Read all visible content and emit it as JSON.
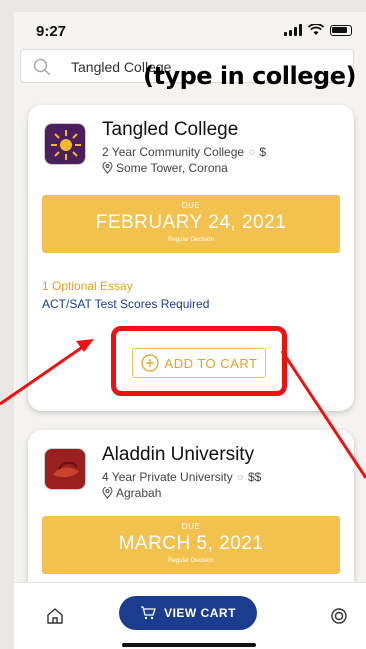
{
  "status_bar": {
    "time": "9:27"
  },
  "search": {
    "value": "Tangled College"
  },
  "annotation": {
    "text": "(type in college)"
  },
  "cards": [
    {
      "name": "Tangled College",
      "type": "2 Year Community College",
      "cost": "$",
      "location": "Some Tower, Corona",
      "due_label": "DUE",
      "due_date": "FEBRUARY 24, 2021",
      "decision": "Regular Decision",
      "essays": "1 Optional Essay",
      "tests": "ACT/SAT Test Scores Required",
      "add_to_cart": "ADD TO CART"
    },
    {
      "name": "Aladdin University",
      "type": "4 Year Private University",
      "cost": "$$",
      "location": "Agrabah",
      "due_label": "DUE",
      "due_date": "MARCH 5, 2021",
      "decision": "Regular Decision"
    }
  ],
  "bottom_bar": {
    "view_cart": "VIEW CART"
  },
  "colors": {
    "due_box": "#f2c14e",
    "accent_gold": "#e0a320",
    "primary_blue": "#1a3d8f",
    "annotation_red": "#e11111"
  },
  "icons": [
    "search-icon",
    "pin-icon",
    "plus-circle-icon",
    "home-icon",
    "cart-icon",
    "gear-icon",
    "signal-icon",
    "wifi-icon",
    "battery-icon"
  ]
}
